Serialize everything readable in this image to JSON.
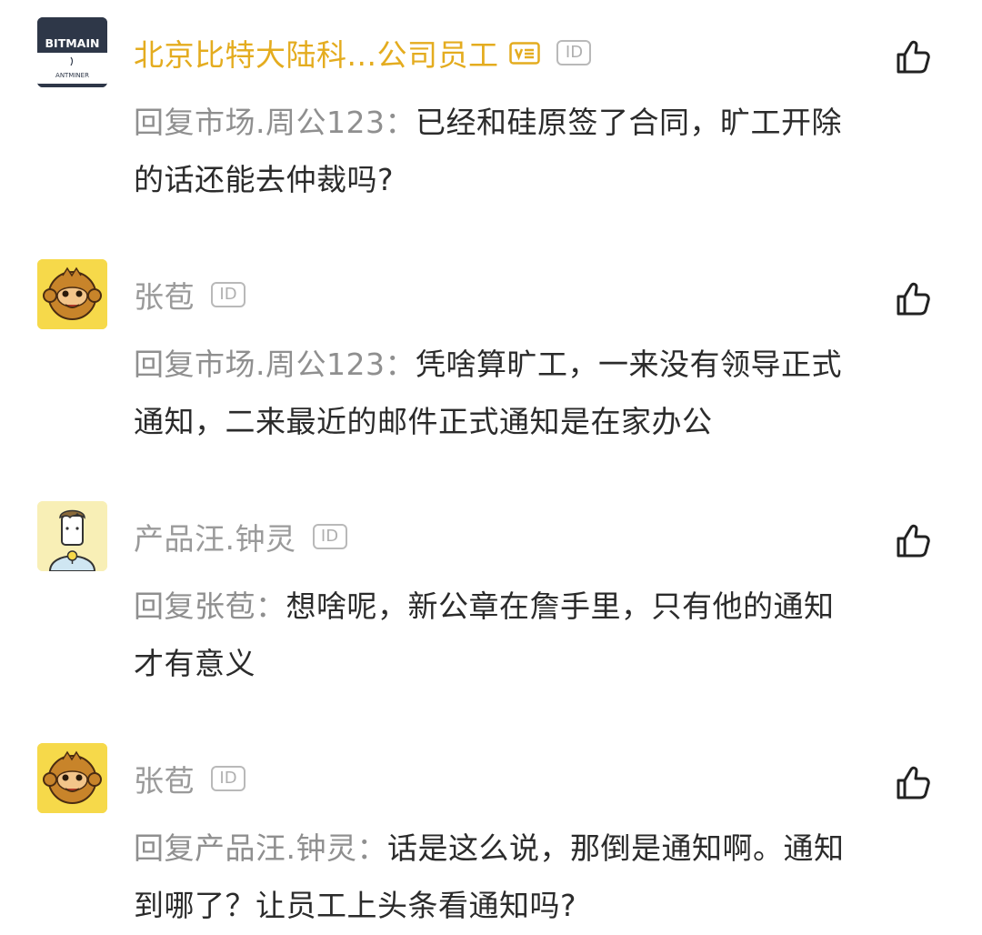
{
  "comments": [
    {
      "username": "北京比特大陆科...公司员工",
      "username_highlight": true,
      "vip_badge": true,
      "id_badge": "ID",
      "reply_prefix": "回复市场.周公123：",
      "content": "已经和硅原签了合同，旷工开除的话还能去仲裁吗?",
      "avatar": {
        "type": "bitmain-logo",
        "line1": "BITMAIN",
        "line2": "ANTMINER",
        "bg": "#2e3748"
      }
    },
    {
      "username": "张苞",
      "username_highlight": false,
      "vip_badge": false,
      "id_badge": "ID",
      "reply_prefix": "回复市场.周公123：",
      "content": "凭啥算旷工，一来没有领导正式通知，二来最近的邮件正式通知是在家办公",
      "avatar": {
        "type": "monkey-icon",
        "bg": "#f6d94a"
      }
    },
    {
      "username": "产品汪.钟灵",
      "username_highlight": false,
      "vip_badge": false,
      "id_badge": "ID",
      "reply_prefix": "回复张苞：",
      "content": "想啥呢，新公章在詹手里，只有他的通知才有意义",
      "avatar": {
        "type": "cartoon-person-icon",
        "bg": "#f8efb6"
      }
    },
    {
      "username": "张苞",
      "username_highlight": false,
      "vip_badge": false,
      "id_badge": "ID",
      "reply_prefix": "回复产品汪.钟灵：",
      "content": "话是这么说，那倒是通知啊。通知到哪了？让员工上头条看通知吗?",
      "avatar": {
        "type": "monkey-icon",
        "bg": "#f6d94a"
      }
    }
  ],
  "icons": {
    "like": "thumbs-up-icon",
    "vip": "verified-badge-icon",
    "id": "id-badge-icon"
  },
  "colors": {
    "highlight_name": "#e4ac1f",
    "name": "#9a9a9a",
    "reply_prefix": "#8f8f8f",
    "text": "#2b2b2b"
  }
}
